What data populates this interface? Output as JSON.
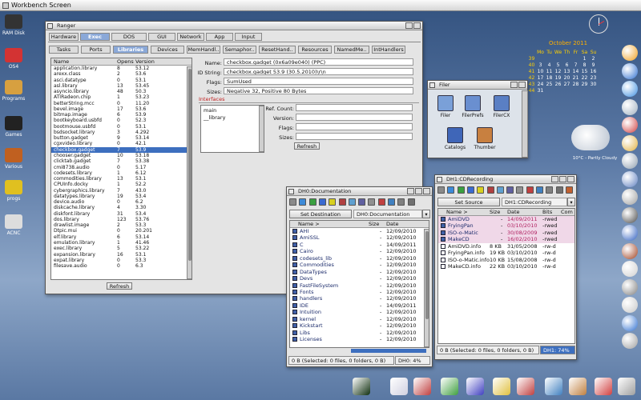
{
  "screen": {
    "title": "Workbench Screen"
  },
  "desktop_icons": [
    {
      "label": "RAM Disk",
      "icon": "ram-disk-icon",
      "color": "#333333"
    },
    {
      "label": "OS4",
      "icon": "amiga-ball-icon",
      "color": "#d33333"
    },
    {
      "label": "Programs",
      "icon": "drawer-icon",
      "color": "#d7a040"
    },
    {
      "label": "Games",
      "icon": "drive-icon",
      "color": "#222222"
    },
    {
      "label": "Various",
      "icon": "drawer-icon",
      "color": "#c06020"
    },
    {
      "label": "progs",
      "icon": "cd-icon",
      "color": "#e0c020"
    },
    {
      "label": "ACNC",
      "icon": "drive-icon",
      "color": "#dddddd"
    }
  ],
  "ranger": {
    "title": "Ranger",
    "tabs_row1": [
      "Hardware",
      "Exec",
      "DOS",
      "GUI",
      "Network",
      "App",
      "Input"
    ],
    "active_tab_row1": "Exec",
    "tabs_row2": [
      "Tasks",
      "Ports",
      "Libraries",
      "Devices",
      "MemHandl..",
      "Semaphor..",
      "ResetHand..",
      "Resources",
      "NamedMe..",
      "IntHandlers"
    ],
    "active_tab_row2": "Libraries",
    "list_headers": {
      "name": "Name",
      "opens": "Opens",
      "version": "Version"
    },
    "libraries": [
      [
        "application.library",
        "8",
        "53.12"
      ],
      [
        "arexx.class",
        "2",
        "53.6"
      ],
      [
        "asci.datatype",
        "0",
        "53.1"
      ],
      [
        "asl.library",
        "13",
        "53.45"
      ],
      [
        "asyncio.library",
        "48",
        "50.3"
      ],
      [
        "ATIRadeon.chip",
        "1",
        "53.23"
      ],
      [
        "betterString.mcc",
        "0",
        "11.20"
      ],
      [
        "bevel.image",
        "17",
        "53.6"
      ],
      [
        "bitmap.image",
        "6",
        "53.9"
      ],
      [
        "bootkeyboard.usbfd",
        "0",
        "52.3"
      ],
      [
        "bootmouse.usbfd",
        "0",
        "53.1"
      ],
      [
        "bsdsocket.library",
        "3",
        "4.292"
      ],
      [
        "button.gadget",
        "9",
        "53.14"
      ],
      [
        "cgxvideo.library",
        "0",
        "42.1"
      ],
      [
        "checkbox.gadget",
        "7",
        "53.9"
      ],
      [
        "chooser.gadget",
        "10",
        "53.18"
      ],
      [
        "clicktab.gadget",
        "7",
        "53.38"
      ],
      [
        "cmi8738.audio",
        "0",
        "5.17"
      ],
      [
        "codesets.library",
        "1",
        "6.12"
      ],
      [
        "commodities.library",
        "13",
        "53.1"
      ],
      [
        "CPUInfo.docky",
        "1",
        "52.2"
      ],
      [
        "cybergraphics.library",
        "7",
        "43.0"
      ],
      [
        "datatypes.library",
        "19",
        "53.4"
      ],
      [
        "device.audio",
        "0",
        "6.2"
      ],
      [
        "diskcache.library",
        "4",
        "3.30"
      ],
      [
        "diskfont.library",
        "31",
        "53.4"
      ],
      [
        "dos.library",
        "123",
        "53.76"
      ],
      [
        "drawlist.image",
        "2",
        "53.3"
      ],
      [
        "Dtpic.mui",
        "0",
        "20.201"
      ],
      [
        "elf.library",
        "6",
        "53.14"
      ],
      [
        "emulation.library",
        "1",
        "41.46"
      ],
      [
        "exec.library",
        "5",
        "53.22"
      ],
      [
        "expansion.library",
        "16",
        "53.1"
      ],
      [
        "expat.library",
        "0",
        "53.3"
      ],
      [
        "filesave.audio",
        "0",
        "6.3"
      ]
    ],
    "selected_library": "checkbox.gadget",
    "detail": {
      "name_label": "Name:",
      "name": "checkbox.gadget (0x6a09e040) (PPC)",
      "idstring_label": "ID String:",
      "idstring": "checkbox.gadget 53.9 (30.5.2010)\\r\\n",
      "flags_label": "Flags:",
      "flags": "SumUsed",
      "sizes_label": "Sizes:",
      "sizes": "Negative 32, Positive 80 Bytes",
      "interfaces_label": "Interfaces",
      "interfaces": [
        "main",
        "__library"
      ],
      "refcount_label": "Ref. Count:",
      "version_label": "Version:",
      "iflags_label": "Flags:",
      "isizes_label": "Sizes:",
      "refresh2": "Refresh"
    },
    "refresh": "Refresh"
  },
  "calendar": {
    "title": "October 2011",
    "days": [
      "Mo",
      "Tu",
      "We",
      "Th",
      "Fr",
      "Sa",
      "Su"
    ],
    "weeks": [
      [
        "39",
        "",
        "",
        "",
        "",
        "",
        "1",
        "2"
      ],
      [
        "40",
        "3",
        "4",
        "5",
        "6",
        "7",
        "8",
        "9"
      ],
      [
        "41",
        "10",
        "11",
        "12",
        "13",
        "14",
        "15",
        "16"
      ],
      [
        "42",
        "17",
        "18",
        "19",
        "20",
        "21",
        "22",
        "23"
      ],
      [
        "43",
        "24",
        "25",
        "26",
        "27",
        "28",
        "29",
        "30"
      ],
      [
        "44",
        "31",
        "",
        "",
        "",
        "",
        "",
        ""
      ]
    ]
  },
  "weather": {
    "text": "10°C - Partly Cloudy"
  },
  "filer": {
    "title": "Filer",
    "items": [
      {
        "label": "Filer",
        "icon": "filer-icon"
      },
      {
        "label": "FilerPrefs",
        "icon": "filer-prefs-icon"
      },
      {
        "label": "FilerCX",
        "icon": "filer-cx-icon"
      },
      {
        "label": "Catalogs",
        "icon": "catalogs-drawer-icon"
      },
      {
        "label": "Thumber",
        "icon": "thumber-icon"
      }
    ]
  },
  "dh0": {
    "title": "DH0:Documentation",
    "dest_button": "Set Destination",
    "path": "DH0:Documentation",
    "headers": {
      "name": "Name >",
      "size": "Size",
      "date": "Date"
    },
    "files": [
      [
        "AHI",
        "-",
        "12/09/2010"
      ],
      [
        "AmiSSL",
        "-",
        "12/09/2010"
      ],
      [
        "C",
        "-",
        "14/09/2011"
      ],
      [
        "Cairo",
        "-",
        "12/09/2010"
      ],
      [
        "codesets_lib",
        "-",
        "12/09/2010"
      ],
      [
        "Commodities",
        "-",
        "12/09/2010"
      ],
      [
        "DataTypes",
        "-",
        "12/09/2010"
      ],
      [
        "Devs",
        "-",
        "12/09/2010"
      ],
      [
        "FastFileSystem",
        "-",
        "12/09/2010"
      ],
      [
        "Fonts",
        "-",
        "12/09/2010"
      ],
      [
        "handlers",
        "-",
        "12/09/2010"
      ],
      [
        "IDE",
        "-",
        "14/09/2011"
      ],
      [
        "Intuition",
        "-",
        "12/09/2010"
      ],
      [
        "kernel",
        "-",
        "12/09/2010"
      ],
      [
        "Kickstart",
        "-",
        "12/09/2010"
      ],
      [
        "Libs",
        "-",
        "12/09/2010"
      ],
      [
        "Licenses",
        "-",
        "12/09/2010"
      ]
    ],
    "status": "0 B (Selected: 0 files, 0 folders, 0 B)",
    "usage": "DH0: 4%"
  },
  "dh1": {
    "title": "DH1:CDRecording",
    "source_button": "Set Source",
    "path": "DH1:CDRecording",
    "headers": {
      "name": "Name >",
      "size": "Size",
      "date": "Date",
      "bits": "Bits",
      "com": "Com"
    },
    "files": [
      [
        "AmiDVD",
        "-",
        "14/09/2011",
        "-rwed"
      ],
      [
        "FryingPan",
        "-",
        "03/10/2010",
        "-rwed"
      ],
      [
        "ISO-o-Matic",
        "-",
        "30/08/2009",
        "-rwed"
      ],
      [
        "MakeCD",
        "-",
        "16/02/2010",
        "-rwed"
      ],
      [
        "AmiDVD.info",
        "8 KB",
        "31/05/2008",
        "-rw-d"
      ],
      [
        "FryingPan.info",
        "19 KB",
        "03/10/2010",
        "-rw-d"
      ],
      [
        "ISO-o-Matic.info",
        "10 KB",
        "15/08/2008",
        "-rw-d"
      ],
      [
        "MakeCD.info",
        "22 KB",
        "03/10/2010",
        "-rw-d"
      ]
    ],
    "status": "0 B (Selected: 0 files, 0 folders, 0 B)",
    "usage": "DH1: 74%"
  }
}
